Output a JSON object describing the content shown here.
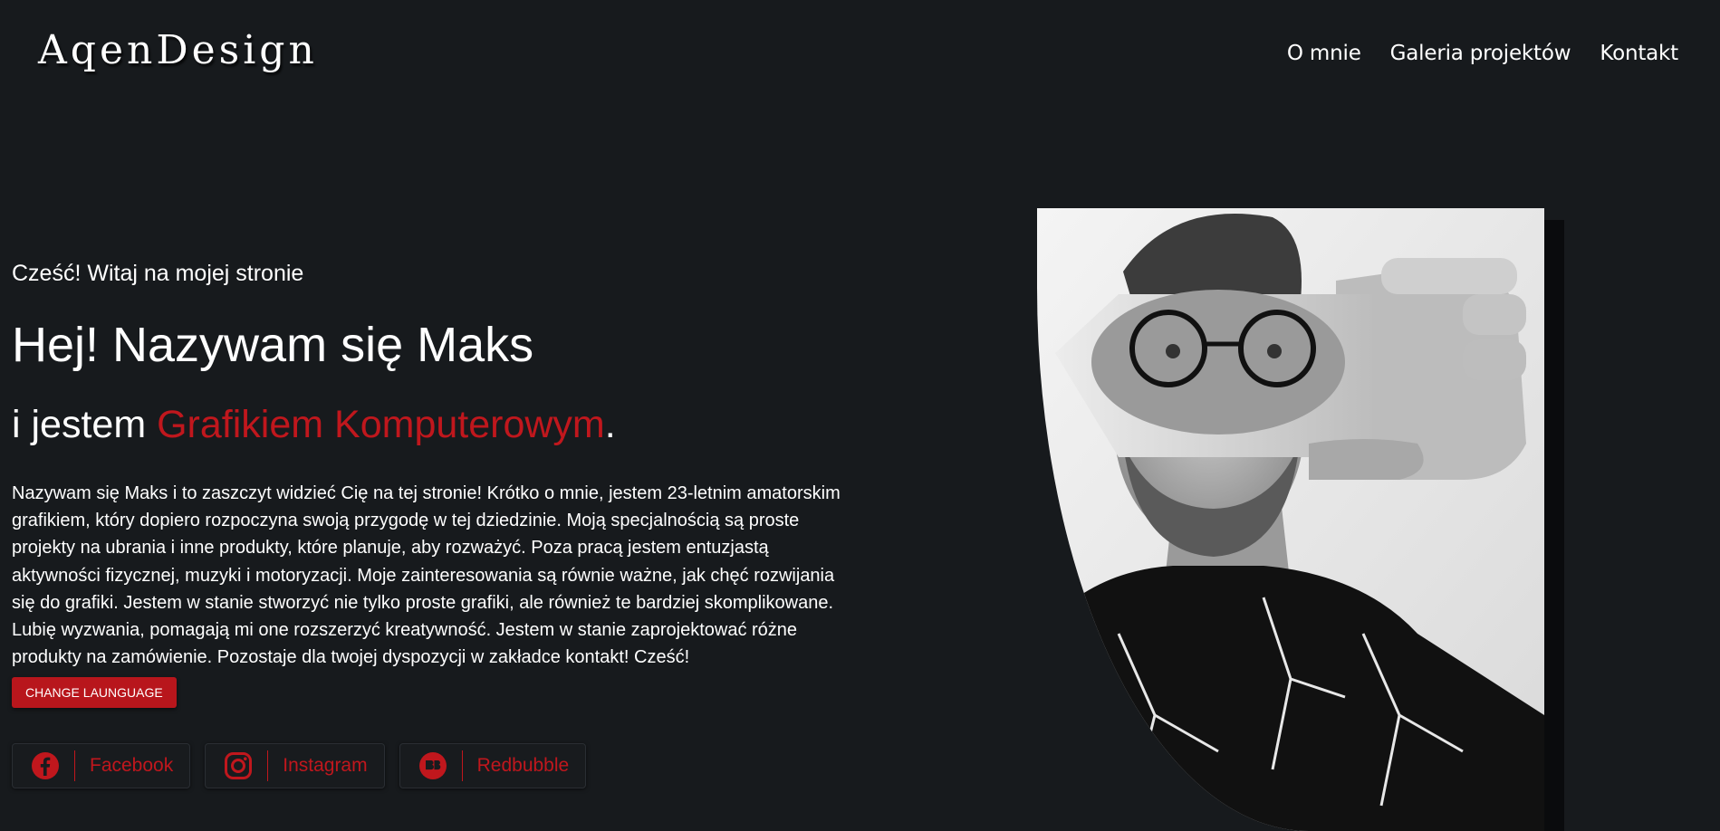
{
  "header": {
    "logo": "AqenDesign",
    "nav": [
      "O mnie",
      "Galeria projektów",
      "Kontakt"
    ]
  },
  "hero": {
    "greeting": "Cześć! Witaj na mojej stronie",
    "headline": "Hej! Nazywam się Maks",
    "subline_prefix": "i jestem ",
    "subline_accent": "Grafikiem Komputerowym",
    "subline_suffix": ".",
    "bio": "Nazywam się Maks i to zaszczyt widzieć Cię na tej stronie! Krótko o mnie, jestem 23-letnim amatorskim grafikiem, który dopiero rozpoczyna swoją przygodę w tej dziedzinie. Moją specjalnością są proste projekty na ubrania i inne produkty, które planuje, aby rozważyć. Poza pracą jestem entuzjastą aktywności fizycznej, muzyki i motoryzacji. Moje zainteresowania są równie ważne, jak chęć rozwijania się do grafiki. Jestem w stanie stworzyć nie tylko proste grafiki, ale również te bardziej skomplikowane. Lubię wyzwania, pomagają mi one rozszerzyć kreatywność. Jestem w stanie zaprojektować różne produkty na zamówienie. Pozostaje dla twojej dyspozycji w zakładce kontakt! Cześć!",
    "language_button": "CHANGE LAUNGUAGE"
  },
  "socials": [
    {
      "label": "Facebook",
      "icon": "facebook-icon"
    },
    {
      "label": "Instagram",
      "icon": "instagram-icon"
    },
    {
      "label": "Redbubble",
      "icon": "redbubble-icon"
    }
  ],
  "colors": {
    "background": "#171a1d",
    "accent": "#c0171d",
    "text": "#ffffff"
  },
  "portrait": {
    "description_icon": "portrait-photo"
  }
}
